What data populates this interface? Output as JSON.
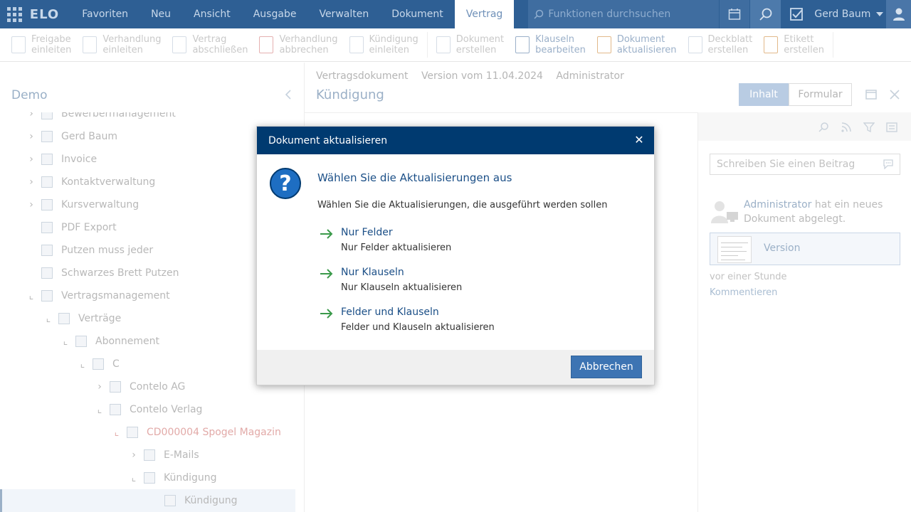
{
  "topbar": {
    "logo": "ELO",
    "menu": [
      "Favoriten",
      "Neu",
      "Ansicht",
      "Ausgabe",
      "Verwalten",
      "Dokument",
      "Vertrag"
    ],
    "active_menu": "Vertrag",
    "search_placeholder": "Funktionen durchsuchen",
    "user": "Gerd Baum"
  },
  "ribbon": [
    {
      "l1": "Freigabe",
      "l2": "einleiten"
    },
    {
      "l1": "Verhandlung",
      "l2": "einleiten"
    },
    {
      "l1": "Vertrag",
      "l2": "abschließen"
    },
    {
      "l1": "Verhandlung",
      "l2": "abbrechen"
    },
    {
      "l1": "Kündigung",
      "l2": "einleiten"
    },
    {
      "l1": "Dokument",
      "l2": "erstellen"
    },
    {
      "l1": "Klauseln",
      "l2": "bearbeiten"
    },
    {
      "l1": "Dokument",
      "l2": "aktualisieren"
    },
    {
      "l1": "Deckblatt",
      "l2": "erstellen"
    },
    {
      "l1": "Etikett",
      "l2": "erstellen"
    }
  ],
  "left": {
    "title": "Demo",
    "tree": [
      {
        "label": "Bewerbermanagement"
      },
      {
        "label": "Gerd Baum"
      },
      {
        "label": "Invoice"
      },
      {
        "label": "Kontaktverwaltung"
      },
      {
        "label": "Kursverwaltung"
      },
      {
        "label": "PDF Export"
      },
      {
        "label": "Putzen muss jeder"
      },
      {
        "label": "Schwarzes Brett Putzen"
      },
      {
        "label": "Vertragsmanagement"
      },
      {
        "label": "Verträge"
      },
      {
        "label": "Abonnement"
      },
      {
        "label": "C"
      },
      {
        "label": "Contelo AG"
      },
      {
        "label": "Contelo Verlag"
      },
      {
        "label": "CD000004 Spogel Magazin"
      },
      {
        "label": "E-Mails"
      },
      {
        "label": "Kündigung"
      },
      {
        "label": "Kündigung"
      }
    ]
  },
  "document": {
    "meta": [
      "Vertragsdokument",
      "Version vom 11.04.2024",
      "Administrator"
    ],
    "title": "Kündigung",
    "tab_content": "Inhalt",
    "tab_form": "Formular"
  },
  "feed": {
    "placeholder": "Schreiben Sie einen Beitrag",
    "author": "Administrator",
    "action": " hat ein neues Dokument abgelegt.",
    "card_label": "Version",
    "time": "vor einer Stunde",
    "comment": "Kommentieren"
  },
  "dialog": {
    "header": "Dokument aktualisieren",
    "title": "Wählen Sie die Aktualisierungen aus",
    "subtitle": "Wählen Sie die Aktualisierungen, die ausgeführt werden sollen",
    "options": [
      {
        "title": "Nur Felder",
        "desc": "Nur Felder aktualisieren"
      },
      {
        "title": "Nur Klauseln",
        "desc": "Nur Klauseln aktualisieren"
      },
      {
        "title": "Felder und Klauseln",
        "desc": "Felder und Klauseln aktualisieren"
      }
    ],
    "cancel": "Abbrechen"
  },
  "colors": {
    "topbar": "#2e5f94",
    "dialog_header": "#003a70",
    "primary_button": "#3d74b3",
    "option_arrow": "#3a9a4a"
  }
}
